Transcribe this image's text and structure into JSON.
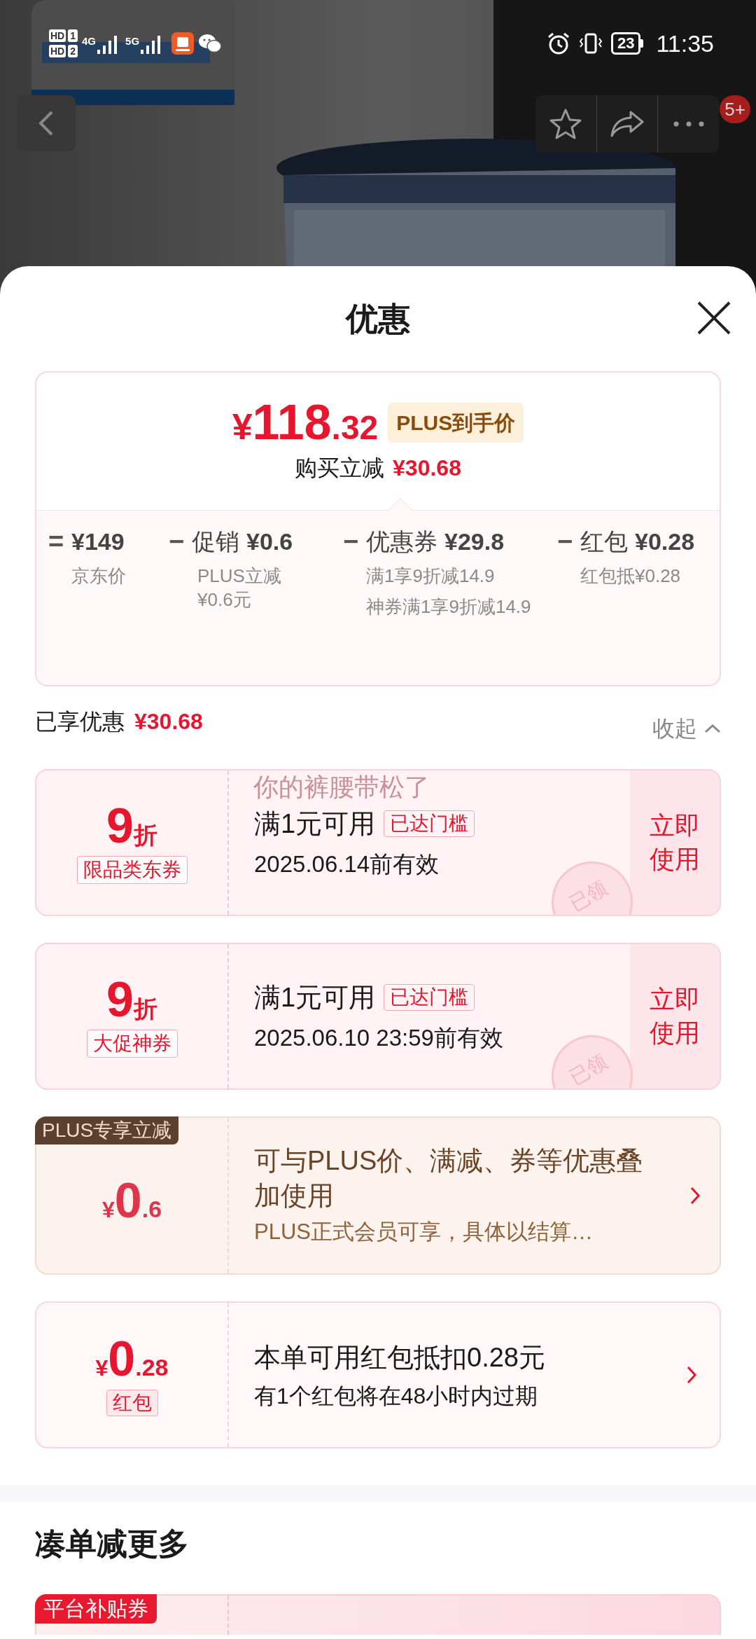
{
  "status_bar": {
    "sim": [
      {
        "hd": "HD",
        "slot": "1",
        "net": "4G"
      },
      {
        "hd": "HD",
        "slot": "2",
        "net": "5G"
      }
    ],
    "battery": "23",
    "time": "11:35"
  },
  "header": {
    "badge": "5+"
  },
  "sheet": {
    "title": "优惠"
  },
  "price_summary": {
    "currency": "¥",
    "price_int": "118",
    "price_dec": ".32",
    "tag": "PLUS到手价",
    "saving_label": "购买立减",
    "saving": "¥30.68"
  },
  "breakdown": [
    {
      "operator": "=",
      "amount": "¥149",
      "notes": [
        "京东价"
      ]
    },
    {
      "operator": "−",
      "label": "促销",
      "amount": "¥0.6",
      "notes": [
        "PLUS立减¥0.6元"
      ]
    },
    {
      "operator": "−",
      "label": "优惠券",
      "amount": "¥29.8",
      "notes": [
        "满1享9折减14.9",
        "神券满1享9折减14.9"
      ]
    },
    {
      "operator": "−",
      "label": "红包",
      "amount": "¥0.28",
      "notes": [
        "红包抵¥0.28"
      ]
    }
  ],
  "enjoyed": {
    "label": "已享优惠",
    "amount": "¥30.68",
    "collapse": "收起"
  },
  "floating_comment": "你的裤腰带松了",
  "coupons": [
    {
      "kind": "discount",
      "value": "9",
      "unit": "折",
      "tag": "限品类东券",
      "title": "满1元可用",
      "badge": "已达门槛",
      "validity": "2025.06.14前有效",
      "action": "立即使用",
      "stamp": "已领"
    },
    {
      "kind": "discount",
      "value": "9",
      "unit": "折",
      "tag": "大促神券",
      "title": "满1元可用",
      "badge": "已达门槛",
      "validity": "2025.06.10 23:59前有效",
      "action": "立即使用",
      "stamp": "已领"
    },
    {
      "kind": "plus",
      "corner": "PLUS专享立减",
      "currency": "¥",
      "value": "0",
      "decimal": ".6",
      "title": "可与PLUS价、满减、券等优惠叠加使用",
      "subtitle": "PLUS正式会员可享，具体以结算…"
    },
    {
      "kind": "redpacket",
      "currency": "¥",
      "value": "0",
      "decimal": ".28",
      "tag": "红包",
      "title": "本单可用红包抵扣0.28元",
      "subtitle": "有1个红包将在48小时内过期"
    }
  ],
  "more": {
    "title": "凑单减更多",
    "cards": [
      {
        "kind": "subsidy",
        "corner": "平台补贴券"
      }
    ]
  }
}
